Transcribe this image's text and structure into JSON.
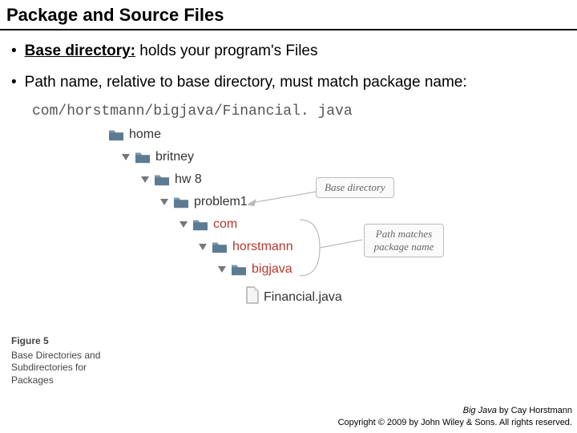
{
  "title": "Package and Source Files",
  "bullets": {
    "b1_lead": "Base directory:",
    "b1_rest": " holds your program's Files",
    "b2": "Path name, relative to base directory, must match package name:"
  },
  "code": "com/horstmann/bigjava/Financial. java",
  "tree": {
    "home": "home",
    "britney": "britney",
    "hw8": "hw 8",
    "problem1": "problem1",
    "com": "com",
    "horstmann": "horstmann",
    "bigjava": "bigjava",
    "file": "Financial.java"
  },
  "callouts": {
    "base": "Base directory",
    "path": "Path matches package name"
  },
  "figure": {
    "num": "Figure 5",
    "caption": "Base Directories and Subdirectories for Packages"
  },
  "footer": {
    "line1_book": "Big Java",
    "line1_rest": " by Cay Horstmann",
    "line2": "Copyright © 2009 by John Wiley & Sons. All rights reserved."
  }
}
